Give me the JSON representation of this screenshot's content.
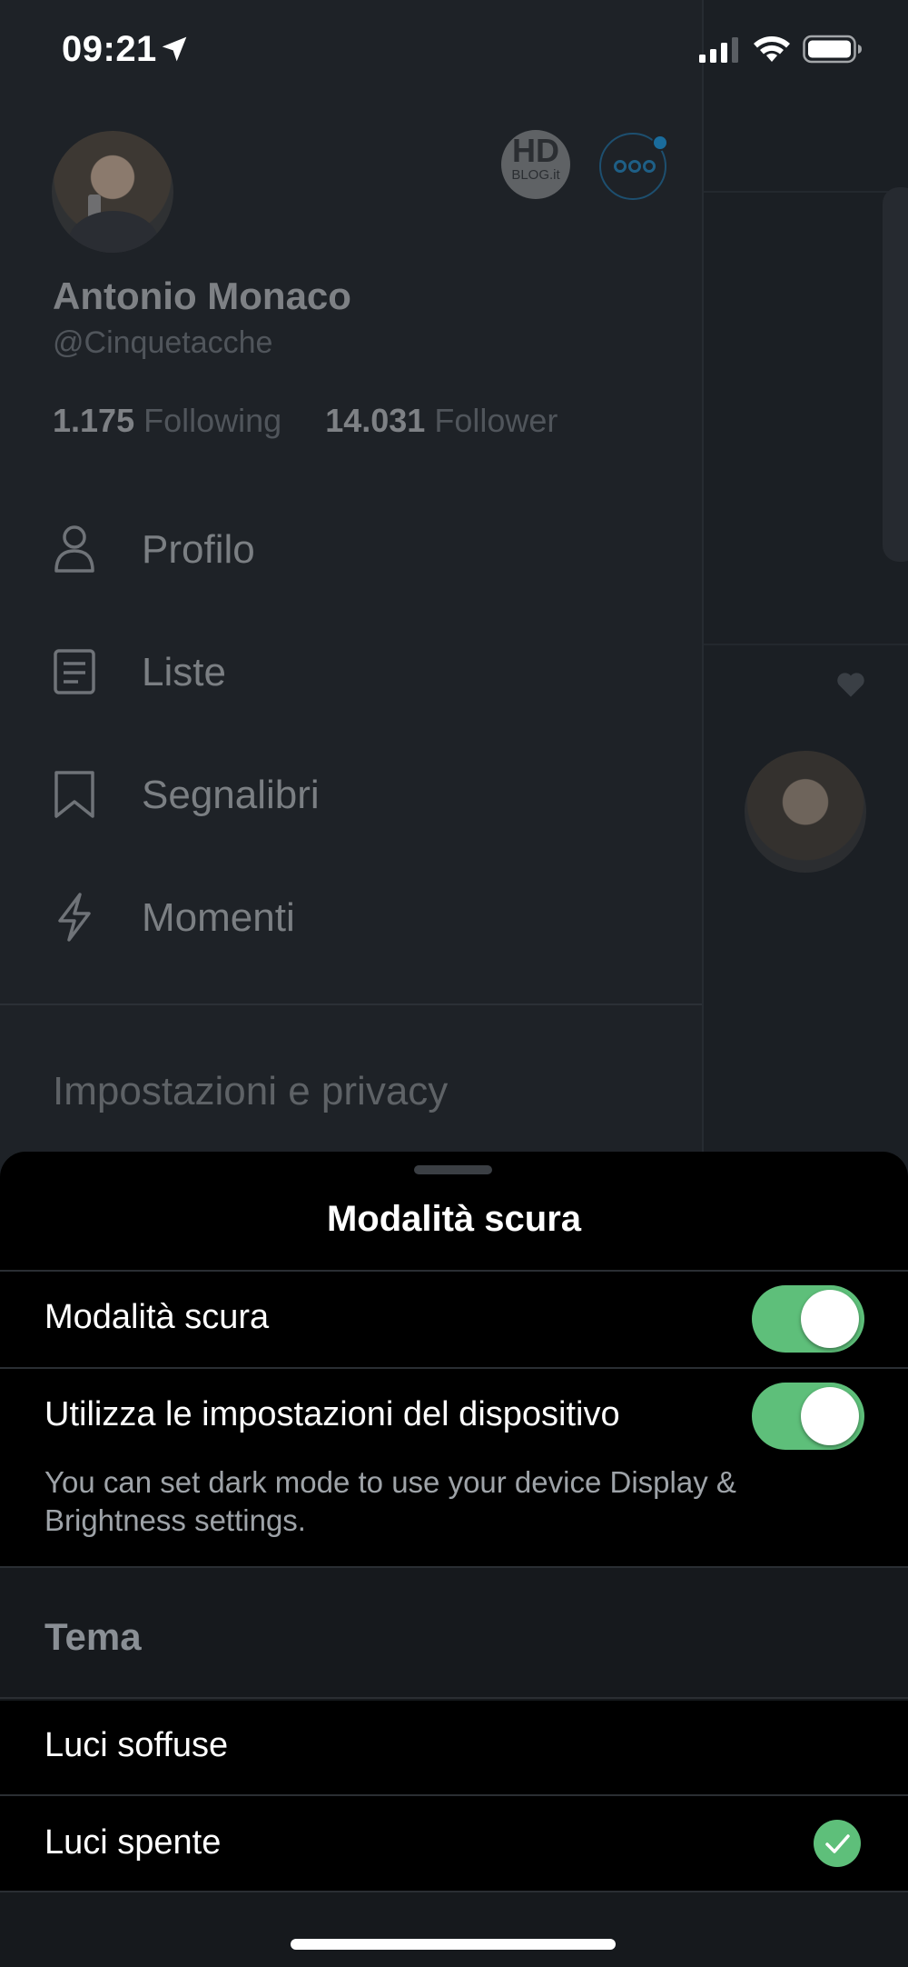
{
  "status_bar": {
    "time": "09:21",
    "icons": [
      "location-arrow-icon",
      "signal-icon",
      "wifi-icon",
      "battery-icon"
    ]
  },
  "profile": {
    "name": "Antonio Monaco",
    "handle": "@Cinquetacche",
    "following_count": "1.175",
    "following_label": "Following",
    "follower_count": "14.031",
    "follower_label": "Follower",
    "other_account_hd": "HD",
    "other_account_blog": "BLOG.it"
  },
  "menu": {
    "items": [
      {
        "label": "Profilo",
        "icon": "person-icon"
      },
      {
        "label": "Liste",
        "icon": "list-icon"
      },
      {
        "label": "Segnalibri",
        "icon": "bookmark-icon"
      },
      {
        "label": "Momenti",
        "icon": "lightning-icon"
      }
    ],
    "settings_label": "Impostazioni e privacy"
  },
  "sheet": {
    "title": "Modalità scura",
    "dark_mode": {
      "label": "Modalità scura",
      "on": true
    },
    "use_device": {
      "label": "Utilizza le impostazioni del dispositivo",
      "on": true
    },
    "help_text": "You can set dark mode to use your device Display & Brightness settings.",
    "theme_section": "Tema",
    "themes": [
      {
        "label": "Luci soffuse",
        "selected": false
      },
      {
        "label": "Luci spente",
        "selected": true
      }
    ]
  },
  "colors": {
    "toggle_on": "#5ebf7a",
    "check": "#5ebf7a",
    "sheet_bg": "#000000"
  }
}
